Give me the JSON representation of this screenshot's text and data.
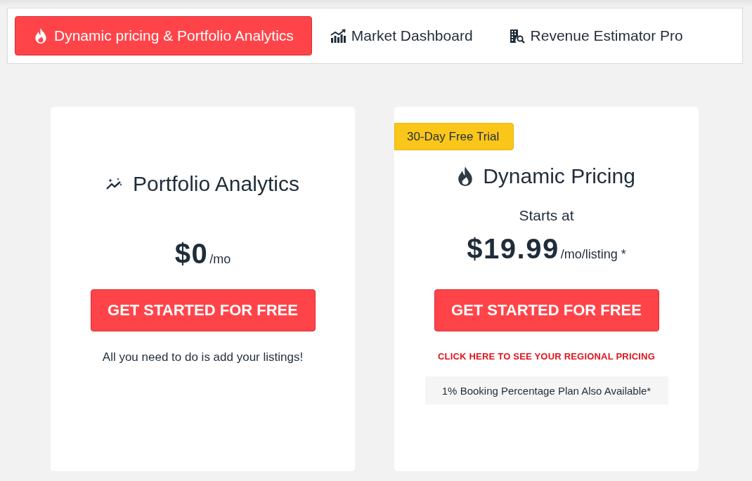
{
  "tabs": [
    {
      "label": "Dynamic pricing & Portfolio Analytics",
      "selected": true
    },
    {
      "label": "Market Dashboard",
      "selected": false
    },
    {
      "label": "Revenue Estimator Pro",
      "selected": false
    }
  ],
  "plans": [
    {
      "title": "Portfolio Analytics",
      "price": "$0",
      "price_unit": "/mo",
      "button": "GET STARTED FOR FREE",
      "note": "All you need to do is add your listings!"
    },
    {
      "badge": "30-Day Free Trial",
      "title": "Dynamic Pricing",
      "price_caption": "Starts at",
      "price": "$19.99",
      "price_unit": "/mo/listing *",
      "button": "GET STARTED FOR FREE",
      "link": "CLICK HERE TO SEE YOUR REGIONAL PRICING",
      "footnote": "1% Booking Percentage Plan Also Available*"
    }
  ]
}
